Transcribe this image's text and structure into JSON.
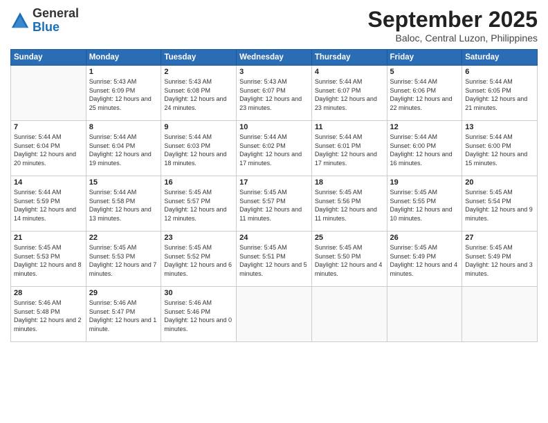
{
  "header": {
    "logo_general": "General",
    "logo_blue": "Blue",
    "month": "September 2025",
    "location": "Baloc, Central Luzon, Philippines"
  },
  "days_of_week": [
    "Sunday",
    "Monday",
    "Tuesday",
    "Wednesday",
    "Thursday",
    "Friday",
    "Saturday"
  ],
  "weeks": [
    [
      {
        "day": "",
        "sunrise": "",
        "sunset": "",
        "daylight": ""
      },
      {
        "day": "1",
        "sunrise": "Sunrise: 5:43 AM",
        "sunset": "Sunset: 6:09 PM",
        "daylight": "Daylight: 12 hours and 25 minutes."
      },
      {
        "day": "2",
        "sunrise": "Sunrise: 5:43 AM",
        "sunset": "Sunset: 6:08 PM",
        "daylight": "Daylight: 12 hours and 24 minutes."
      },
      {
        "day": "3",
        "sunrise": "Sunrise: 5:43 AM",
        "sunset": "Sunset: 6:07 PM",
        "daylight": "Daylight: 12 hours and 23 minutes."
      },
      {
        "day": "4",
        "sunrise": "Sunrise: 5:44 AM",
        "sunset": "Sunset: 6:07 PM",
        "daylight": "Daylight: 12 hours and 23 minutes."
      },
      {
        "day": "5",
        "sunrise": "Sunrise: 5:44 AM",
        "sunset": "Sunset: 6:06 PM",
        "daylight": "Daylight: 12 hours and 22 minutes."
      },
      {
        "day": "6",
        "sunrise": "Sunrise: 5:44 AM",
        "sunset": "Sunset: 6:05 PM",
        "daylight": "Daylight: 12 hours and 21 minutes."
      }
    ],
    [
      {
        "day": "7",
        "sunrise": "Sunrise: 5:44 AM",
        "sunset": "Sunset: 6:04 PM",
        "daylight": "Daylight: 12 hours and 20 minutes."
      },
      {
        "day": "8",
        "sunrise": "Sunrise: 5:44 AM",
        "sunset": "Sunset: 6:04 PM",
        "daylight": "Daylight: 12 hours and 19 minutes."
      },
      {
        "day": "9",
        "sunrise": "Sunrise: 5:44 AM",
        "sunset": "Sunset: 6:03 PM",
        "daylight": "Daylight: 12 hours and 18 minutes."
      },
      {
        "day": "10",
        "sunrise": "Sunrise: 5:44 AM",
        "sunset": "Sunset: 6:02 PM",
        "daylight": "Daylight: 12 hours and 17 minutes."
      },
      {
        "day": "11",
        "sunrise": "Sunrise: 5:44 AM",
        "sunset": "Sunset: 6:01 PM",
        "daylight": "Daylight: 12 hours and 17 minutes."
      },
      {
        "day": "12",
        "sunrise": "Sunrise: 5:44 AM",
        "sunset": "Sunset: 6:00 PM",
        "daylight": "Daylight: 12 hours and 16 minutes."
      },
      {
        "day": "13",
        "sunrise": "Sunrise: 5:44 AM",
        "sunset": "Sunset: 6:00 PM",
        "daylight": "Daylight: 12 hours and 15 minutes."
      }
    ],
    [
      {
        "day": "14",
        "sunrise": "Sunrise: 5:44 AM",
        "sunset": "Sunset: 5:59 PM",
        "daylight": "Daylight: 12 hours and 14 minutes."
      },
      {
        "day": "15",
        "sunrise": "Sunrise: 5:44 AM",
        "sunset": "Sunset: 5:58 PM",
        "daylight": "Daylight: 12 hours and 13 minutes."
      },
      {
        "day": "16",
        "sunrise": "Sunrise: 5:45 AM",
        "sunset": "Sunset: 5:57 PM",
        "daylight": "Daylight: 12 hours and 12 minutes."
      },
      {
        "day": "17",
        "sunrise": "Sunrise: 5:45 AM",
        "sunset": "Sunset: 5:57 PM",
        "daylight": "Daylight: 12 hours and 11 minutes."
      },
      {
        "day": "18",
        "sunrise": "Sunrise: 5:45 AM",
        "sunset": "Sunset: 5:56 PM",
        "daylight": "Daylight: 12 hours and 11 minutes."
      },
      {
        "day": "19",
        "sunrise": "Sunrise: 5:45 AM",
        "sunset": "Sunset: 5:55 PM",
        "daylight": "Daylight: 12 hours and 10 minutes."
      },
      {
        "day": "20",
        "sunrise": "Sunrise: 5:45 AM",
        "sunset": "Sunset: 5:54 PM",
        "daylight": "Daylight: 12 hours and 9 minutes."
      }
    ],
    [
      {
        "day": "21",
        "sunrise": "Sunrise: 5:45 AM",
        "sunset": "Sunset: 5:53 PM",
        "daylight": "Daylight: 12 hours and 8 minutes."
      },
      {
        "day": "22",
        "sunrise": "Sunrise: 5:45 AM",
        "sunset": "Sunset: 5:53 PM",
        "daylight": "Daylight: 12 hours and 7 minutes."
      },
      {
        "day": "23",
        "sunrise": "Sunrise: 5:45 AM",
        "sunset": "Sunset: 5:52 PM",
        "daylight": "Daylight: 12 hours and 6 minutes."
      },
      {
        "day": "24",
        "sunrise": "Sunrise: 5:45 AM",
        "sunset": "Sunset: 5:51 PM",
        "daylight": "Daylight: 12 hours and 5 minutes."
      },
      {
        "day": "25",
        "sunrise": "Sunrise: 5:45 AM",
        "sunset": "Sunset: 5:50 PM",
        "daylight": "Daylight: 12 hours and 4 minutes."
      },
      {
        "day": "26",
        "sunrise": "Sunrise: 5:45 AM",
        "sunset": "Sunset: 5:49 PM",
        "daylight": "Daylight: 12 hours and 4 minutes."
      },
      {
        "day": "27",
        "sunrise": "Sunrise: 5:45 AM",
        "sunset": "Sunset: 5:49 PM",
        "daylight": "Daylight: 12 hours and 3 minutes."
      }
    ],
    [
      {
        "day": "28",
        "sunrise": "Sunrise: 5:46 AM",
        "sunset": "Sunset: 5:48 PM",
        "daylight": "Daylight: 12 hours and 2 minutes."
      },
      {
        "day": "29",
        "sunrise": "Sunrise: 5:46 AM",
        "sunset": "Sunset: 5:47 PM",
        "daylight": "Daylight: 12 hours and 1 minute."
      },
      {
        "day": "30",
        "sunrise": "Sunrise: 5:46 AM",
        "sunset": "Sunset: 5:46 PM",
        "daylight": "Daylight: 12 hours and 0 minutes."
      },
      {
        "day": "",
        "sunrise": "",
        "sunset": "",
        "daylight": ""
      },
      {
        "day": "",
        "sunrise": "",
        "sunset": "",
        "daylight": ""
      },
      {
        "day": "",
        "sunrise": "",
        "sunset": "",
        "daylight": ""
      },
      {
        "day": "",
        "sunrise": "",
        "sunset": "",
        "daylight": ""
      }
    ]
  ]
}
